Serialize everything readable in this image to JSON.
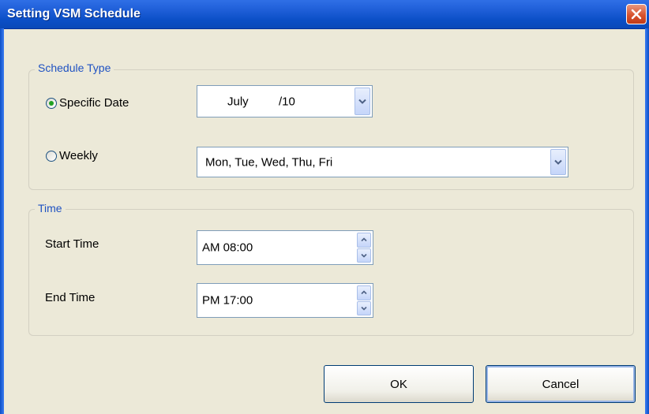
{
  "window": {
    "title": "Setting VSM Schedule"
  },
  "schedule_type": {
    "legend": "Schedule Type",
    "specific_date": {
      "label": "Specific Date",
      "selected": true,
      "month": "July",
      "day": "/10"
    },
    "weekly": {
      "label": "Weekly",
      "selected": false,
      "days": "Mon, Tue, Wed, Thu, Fri"
    }
  },
  "time": {
    "legend": "Time",
    "start": {
      "label": "Start Time",
      "value": "AM 08:00"
    },
    "end": {
      "label": "End Time",
      "value": "PM 17:00"
    }
  },
  "buttons": {
    "ok": "OK",
    "cancel": "Cancel"
  },
  "icons": {
    "close": "close-icon",
    "dropdown": "chevron-down-icon",
    "spin_up": "arrow-up-icon",
    "spin_down": "arrow-down-icon"
  },
  "colors": {
    "titlebar": "#0b4fc7",
    "close": "#d8532e",
    "legend_text": "#1f52c2",
    "radio_dot": "#21a121",
    "dialog_bg": "#ece9d8"
  }
}
